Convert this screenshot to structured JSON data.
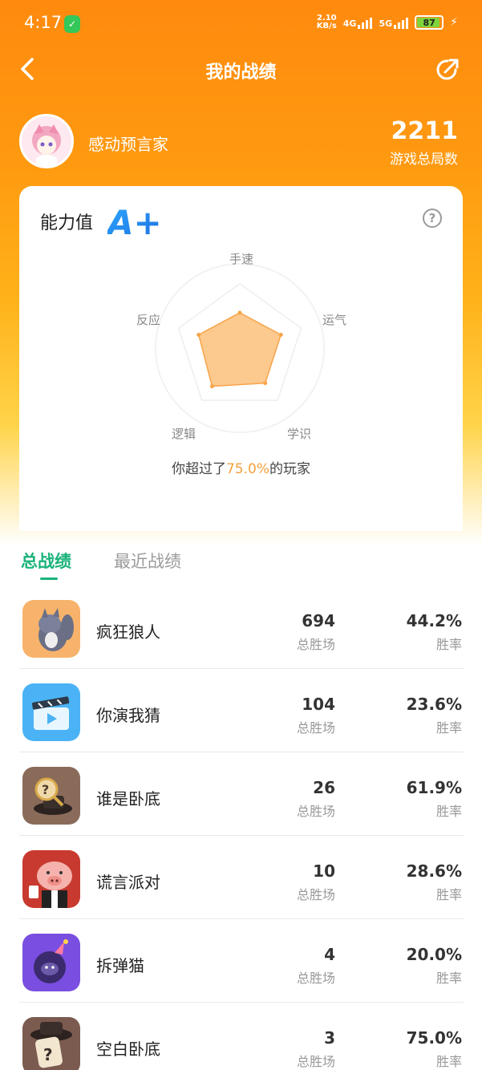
{
  "status_bar": {
    "time": "4:17",
    "speed_value": "2.10",
    "speed_unit": "KB/s",
    "net1": "4G",
    "net2": "5G",
    "battery": "87"
  },
  "nav": {
    "title": "我的战绩"
  },
  "profile": {
    "nickname": "感动预言家",
    "total_games": "2211",
    "total_games_label": "游戏总局数"
  },
  "ability": {
    "title": "能力值",
    "grade": "A+",
    "axes": [
      "手速",
      "运气",
      "学识",
      "逻辑",
      "反应"
    ],
    "values": [
      0.45,
      0.55,
      0.55,
      0.6,
      0.55
    ],
    "beat_prefix": "你超过了",
    "beat_percent": "75.0%",
    "beat_suffix": "的玩家",
    "accent": "#f7a44a"
  },
  "tabs": {
    "active": "总战绩",
    "other": "最近战绩"
  },
  "games": [
    {
      "name": "疯狂狼人",
      "wins": "694",
      "wins_label": "总胜场",
      "rate": "44.2%",
      "rate_label": "胜率",
      "icon": "wolf-icon"
    },
    {
      "name": "你演我猜",
      "wins": "104",
      "wins_label": "总胜场",
      "rate": "23.6%",
      "rate_label": "胜率",
      "icon": "clapperboard-icon"
    },
    {
      "name": "谁是卧底",
      "wins": "26",
      "wins_label": "总胜场",
      "rate": "61.9%",
      "rate_label": "胜率",
      "icon": "magnifier-hat-icon"
    },
    {
      "name": "谎言派对",
      "wins": "10",
      "wins_label": "总胜场",
      "rate": "28.6%",
      "rate_label": "胜率",
      "icon": "pig-icon"
    },
    {
      "name": "拆弹猫",
      "wins": "4",
      "wins_label": "总胜场",
      "rate": "20.0%",
      "rate_label": "胜率",
      "icon": "bomb-cat-icon"
    },
    {
      "name": "空白卧底",
      "wins": "3",
      "wins_label": "总胜场",
      "rate": "75.0%",
      "rate_label": "胜率",
      "icon": "question-hat-icon"
    }
  ],
  "colors": {
    "brand_orange": "#ff8a0e",
    "tab_green": "#1ab37a"
  }
}
